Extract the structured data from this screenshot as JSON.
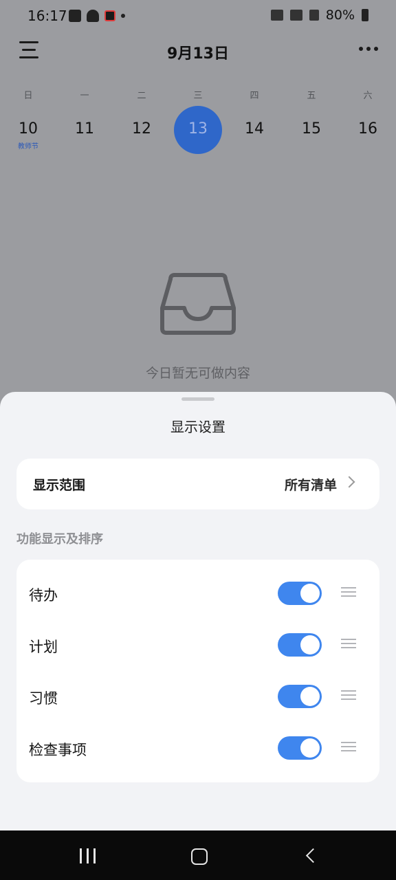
{
  "status": {
    "time": "16:17",
    "battery": "80%"
  },
  "header": {
    "title": "9月13日"
  },
  "week": {
    "weekdays": [
      "日",
      "一",
      "二",
      "三",
      "四",
      "五",
      "六"
    ],
    "days": [
      {
        "num": "10",
        "sub": "教师节"
      },
      {
        "num": "11",
        "sub": ""
      },
      {
        "num": "12",
        "sub": ""
      },
      {
        "num": "13",
        "sub": ""
      },
      {
        "num": "14",
        "sub": ""
      },
      {
        "num": "15",
        "sub": ""
      },
      {
        "num": "16",
        "sub": ""
      }
    ]
  },
  "empty": {
    "text": "今日暂无可做内容"
  },
  "sheet": {
    "title": "显示设置",
    "scope": {
      "label": "显示范围",
      "value": "所有清单"
    },
    "section_heading": "功能显示及排序",
    "items": [
      {
        "label": "待办",
        "enabled": true
      },
      {
        "label": "计划",
        "enabled": true
      },
      {
        "label": "习惯",
        "enabled": true
      },
      {
        "label": "检查事项",
        "enabled": true
      }
    ]
  },
  "colors": {
    "accent": "#3f86ee",
    "selected_day": "#2f67c9"
  }
}
